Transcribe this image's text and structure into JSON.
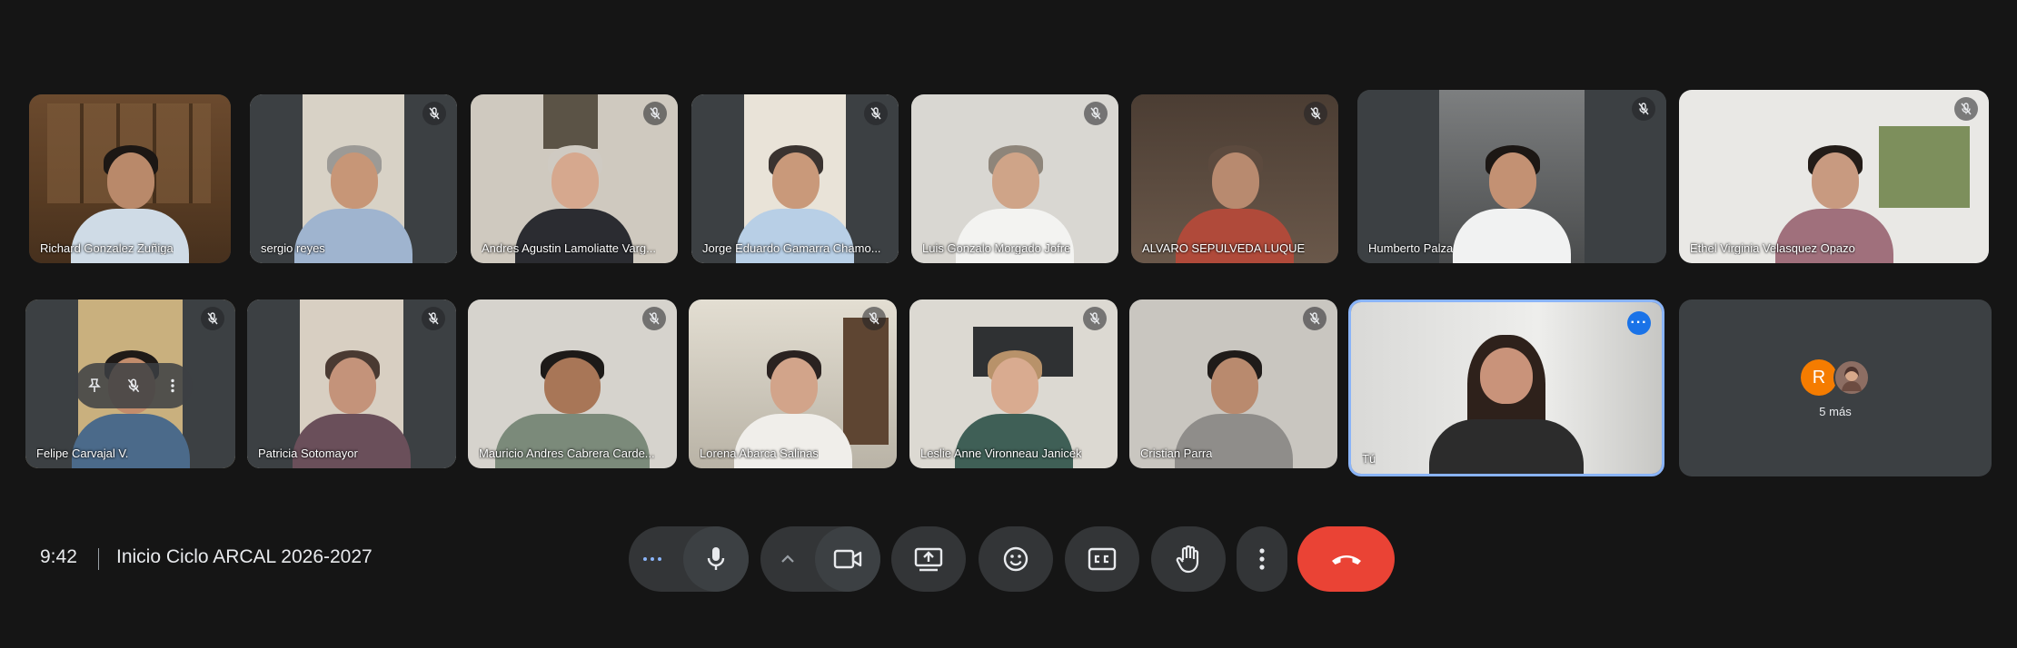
{
  "participants": [
    {
      "name": "Richard Gonzalez Zuñiga"
    },
    {
      "name": "sergio reyes"
    },
    {
      "name": "Andres Agustin Lamoliatte Varg..."
    },
    {
      "name": "Jorge Eduardo Gamarra Chamo..."
    },
    {
      "name": "Luis Gonzalo Morgado Jofre"
    },
    {
      "name": "ALVARO SEPULVEDA LUQUE"
    },
    {
      "name": "Humberto Palza"
    },
    {
      "name": "Ethel Virginia Velasquez Opazo"
    },
    {
      "name": "Felipe Carvajal V."
    },
    {
      "name": "Patricia Sotomayor"
    },
    {
      "name": "Mauricio Andres Cabrera Carde..."
    },
    {
      "name": "Lorena Abarca Salinas"
    },
    {
      "name": "Leslie Anne Vironneau Janicek"
    },
    {
      "name": "Cristian Parra"
    },
    {
      "name": "Tú"
    }
  ],
  "overflow": {
    "avatar_letter": "R",
    "label": "5 más",
    "colors": [
      "#f57c00",
      "#8d6e63"
    ]
  },
  "bottom": {
    "time": "9:42",
    "title": "Inicio Ciclo ARCAL 2026-2027"
  },
  "colors": {
    "accent": "#8ab4f8",
    "hangup": "#ea4335",
    "control_bg": "#333537",
    "background": "#151515"
  },
  "icons": [
    "muted-mic-icon",
    "mic-icon",
    "more-horizontal-icon",
    "chevron-up-icon",
    "camera-icon",
    "present-screen-icon",
    "emoji-icon",
    "captions-icon",
    "raise-hand-icon",
    "more-vertical-icon",
    "hang-up-icon",
    "pin-icon"
  ]
}
